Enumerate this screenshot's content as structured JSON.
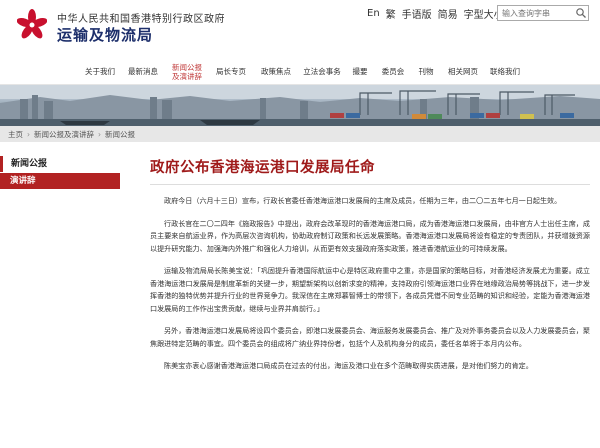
{
  "header": {
    "org_small": "中华人民共和国香港特别行政区政府",
    "org_big": "运输及物流局",
    "lang_en": "En",
    "lang_tc": "繁",
    "sign_language": "手语版",
    "simple_lang": "简易",
    "text_size": "字型大小",
    "search_placeholder": "输入查询字串"
  },
  "nav": {
    "items": [
      "关于我们",
      "最新消息",
      "新闻公报",
      "及演讲辞",
      "局长专页",
      "政策焦点",
      "立法会事务",
      "撮要",
      "委员会",
      "刊物",
      "相关网页",
      "联络我们"
    ]
  },
  "breadcrumb": [
    "主页",
    "新闻公报及演讲辞",
    "新闻公报"
  ],
  "sidebar": {
    "head": "新闻公报",
    "item": "演讲辞"
  },
  "article": {
    "title": "政府公布香港海运港口发展局任命",
    "paras": [
      "政府今日（六月十三日）宣布，行政长官委任香港海运港口发展局的主席及成员，任期为三年，由二〇二五年七月一日起生效。",
      "行政长官在二〇二四年《施政报告》中提出，政府会改革现时的香港海运港口局，成为香港海运港口发展局，由非官方人士出任主席，成员主要来自航运业界，作为高层次咨询机构，协助政府制订政策和长远发展策略。香港海运港口发展局将设有稳定的专责团队，并获增拨资源以提升研究能力、加强海内外推广和强化人力培训，从而更有效支援政府落实政策，推进香港航运业的可持续发展。",
      "运输及物流局局长陈美宝说：「巩固提升香港国际航运中心是特区政府重中之重，亦是国家的策略目标，对香港经济发展尤为重要。成立香港海运港口发展局是制度革新的关键一步，期望新架构以创新求变的精神，支持政府引领海运港口业界在地缘政治局势等挑战下，进一步发挥香港的独特优势并提升行业的世界竞争力。我深信在主席郑慕智博士的带领下，各成员凭借不同专业范畴的知识和经验，定能为香港海运港口发展局的工作作出宝贵贡献，继续与业界并肩前行。」",
      "另外，香港海运港口发展局将设四个委员会，即港口发展委员会、海运服务发展委员会、推广及对外事务委员会以及人力发展委员会，聚焦跟进特定范畴的事宜。四个委员会的组成将广纳业界持份者，包括个人及机构身分的成员，委任名单将于本月内公布。",
      "陈美宝亦衷心感谢香港海运港口局成员在过去的付出，海运及港口业在多个范畴取得实质进展，是对他们努力的肯定。"
    ]
  }
}
